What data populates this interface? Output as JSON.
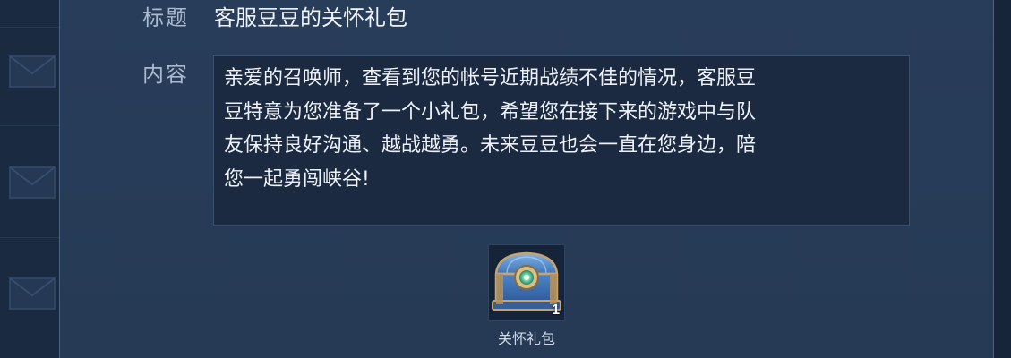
{
  "mail": {
    "title_label": "标题",
    "title_value": "客服豆豆的关怀礼包",
    "content_label": "内容",
    "content_lines": [
      "亲爱的召唤师，查看到您的帐号近期战绩不佳的情况，客服豆",
      "豆特意为您准备了一个小礼包，希望您在接下来的游戏中与队",
      "友保持良好沟通、越战越勇。未来豆豆也会一直在您身边，陪",
      "您一起勇闯峡谷!"
    ]
  },
  "attachment": {
    "name": "关怀礼包",
    "count": "1",
    "icon": "treasure-chest-icon"
  },
  "background": {
    "icon": "mail-envelope-icon"
  },
  "colors": {
    "panel": "#283d5a",
    "content_box": "#1b2a40",
    "label": "#a9b9cf",
    "text": "#eef2f8"
  }
}
